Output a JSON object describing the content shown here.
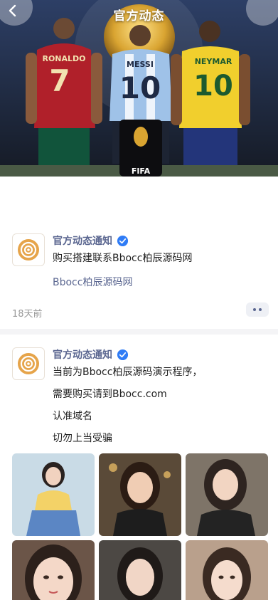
{
  "header": {
    "title": "官方动态",
    "back_icon": "chevron-left-icon"
  },
  "banner": {
    "players": [
      {
        "name": "RONALDO",
        "number": "7"
      },
      {
        "name": "MESSI",
        "number": "10"
      },
      {
        "name": "NEYMAR",
        "number": "10"
      }
    ],
    "logo_text": "FIFA"
  },
  "posts": [
    {
      "author": "官方动态通知",
      "lines": [
        "购买搭建联系Bbocc柏辰源码网"
      ],
      "link": "Bbocc柏辰源码网",
      "time": "18天前"
    },
    {
      "author": "官方动态通知",
      "lines": [
        "当前为Bbocc柏辰源码演示程序，",
        "需要购买请到Bbocc.com",
        "认准域名",
        "切勿上当受骗"
      ]
    }
  ],
  "colors": {
    "author": "#5a6690",
    "verified": "#2f7cf6",
    "divider": "#f4f4f6"
  }
}
